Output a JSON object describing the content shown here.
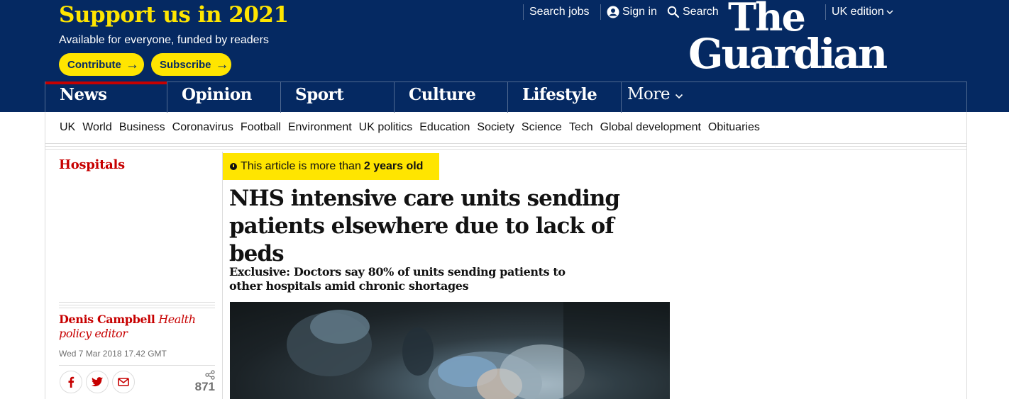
{
  "support": {
    "title": "Support us in 2021",
    "subtitle": "Available for everyone, funded by readers",
    "contribute_label": "Contribute",
    "subscribe_label": "Subscribe"
  },
  "topbar": {
    "search_jobs": "Search jobs",
    "sign_in": "Sign in",
    "search": "Search",
    "edition": "UK edition"
  },
  "logo": {
    "line1": "The",
    "line2": "Guardian"
  },
  "pillars": [
    "News",
    "Opinion",
    "Sport",
    "Culture",
    "Lifestyle"
  ],
  "more_label": "More",
  "subnav": [
    "UK",
    "World",
    "Business",
    "Coronavirus",
    "Football",
    "Environment",
    "UK politics",
    "Education",
    "Society",
    "Science",
    "Tech",
    "Global development",
    "Obituaries"
  ],
  "article": {
    "section": "Hospitals",
    "age_prefix": "This article is more than",
    "age_value": "2 years old",
    "headline": "NHS intensive care units sending patients elsewhere due to lack of beds",
    "standfirst": "Exclusive: Doctors say 80% of units sending patients to other hospitals amid chronic shortages",
    "author": "Denis Campbell",
    "author_role": "Health policy editor",
    "date": "Wed 7 Mar 2018 17.42 GMT",
    "share_count": "871"
  },
  "colors": {
    "brand_blue": "#052962",
    "highlight_yellow": "#ffe500",
    "news_red": "#c70000"
  },
  "icons": {
    "sign_in": "user-icon",
    "search": "search-icon",
    "edition": "chevron-down-icon",
    "share": [
      "facebook-icon",
      "twitter-icon",
      "email-icon"
    ],
    "share_count": "share-icon",
    "age": "clock-icon"
  }
}
